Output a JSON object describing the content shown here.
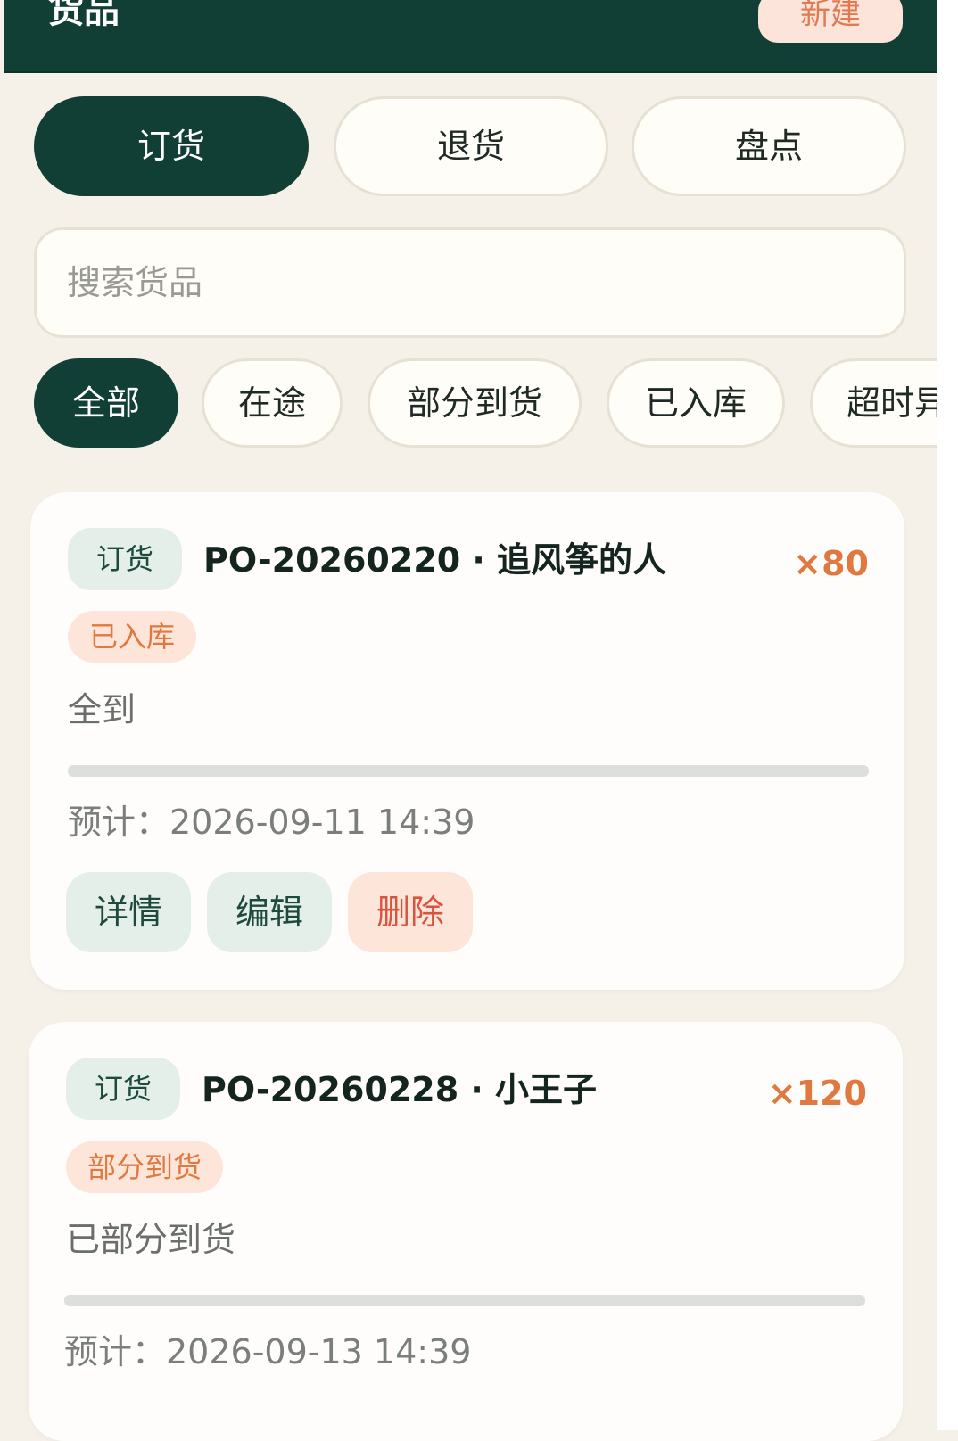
{
  "header": {
    "title": "货品",
    "new_label": "新建"
  },
  "tabs": [
    {
      "label": "订货",
      "active": true
    },
    {
      "label": "退货",
      "active": false
    },
    {
      "label": "盘点",
      "active": false
    }
  ],
  "search": {
    "placeholder": "搜索货品",
    "value": ""
  },
  "filters": [
    {
      "label": "全部",
      "active": true
    },
    {
      "label": "在途",
      "active": false
    },
    {
      "label": "部分到货",
      "active": false
    },
    {
      "label": "已入库",
      "active": false
    },
    {
      "label": "超时异",
      "active": false
    }
  ],
  "orders": [
    {
      "type": "订货",
      "title": "PO-20260220 · 追风筝的人",
      "qty": "×80",
      "status": "已入库",
      "note": "全到",
      "eta": "预计：2026-09-11 14:39",
      "actions": {
        "detail": "详情",
        "edit": "编辑",
        "delete": "删除"
      }
    },
    {
      "type": "订货",
      "title": "PO-20260228 · 小王子",
      "qty": "×120",
      "status": "部分到货",
      "note": "已部分到货",
      "eta": "预计：2026-09-13 14:39"
    }
  ],
  "colors": {
    "primary": "#123f35",
    "accent": "#e0793f",
    "danger": "#d9543f",
    "background": "#f5f1e8"
  }
}
